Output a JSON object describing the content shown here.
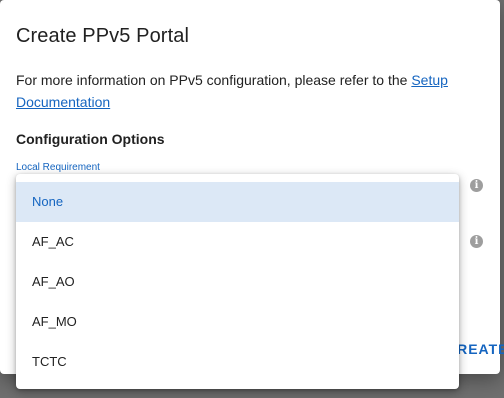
{
  "dialog": {
    "title": "Create PPv5 Portal",
    "info_text": "For more information on PPv5 configuration, please refer to the ",
    "info_link": "Setup Documentation",
    "section_heading": "Configuration Options",
    "field_label": "Local Requirement",
    "create_button_label": "CREATE"
  },
  "dropdown": {
    "options": [
      "None",
      "AF_AC",
      "AF_AO",
      "AF_MO",
      "TCTC"
    ],
    "selected": "None"
  },
  "icons": {
    "info_glyph": "i",
    "info_icon_name": "info-icon"
  },
  "colors": {
    "accent": "#1565c0",
    "selected_bg": "#dce8f6",
    "overlay": "#6f6f6f"
  }
}
